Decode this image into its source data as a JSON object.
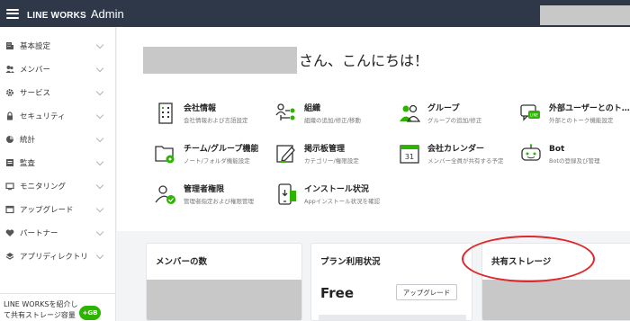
{
  "header": {
    "logo": "LINE WORKS",
    "product": "Admin"
  },
  "sidebar": {
    "items": [
      {
        "label": "基本設定",
        "icon": "building-icon"
      },
      {
        "label": "メンバー",
        "icon": "members-icon"
      },
      {
        "label": "サービス",
        "icon": "gear-icon"
      },
      {
        "label": "セキュリティ",
        "icon": "lock-icon"
      },
      {
        "label": "統計",
        "icon": "pie-chart-icon"
      },
      {
        "label": "監査",
        "icon": "audit-icon"
      },
      {
        "label": "モニタリング",
        "icon": "monitor-icon"
      },
      {
        "label": "アップグレード",
        "icon": "upgrade-icon"
      },
      {
        "label": "パートナー",
        "icon": "partner-icon"
      },
      {
        "label": "アプリディレクトリ",
        "icon": "layers-icon"
      }
    ],
    "promo": {
      "line1": "LINE WORKSを紹介し",
      "line2": "て共有ストレージ容量",
      "badge": "+GB"
    }
  },
  "welcome": {
    "greeting": "さん、こんにちは！"
  },
  "apps": [
    {
      "title": "会社情報",
      "desc": "会社情報および言語設定",
      "icon": "company-icon"
    },
    {
      "title": "組織",
      "desc": "組織の追加/修正/移動",
      "icon": "organization-icon"
    },
    {
      "title": "グループ",
      "desc": "グループの追加/修正",
      "icon": "group-icon"
    },
    {
      "title": "外部ユーザーとのト…",
      "desc": "外部とのトーク機能設定",
      "icon": "external-chat-icon"
    },
    {
      "title": "チーム/グループ機能",
      "desc": "ノート/フォルダ機能設定",
      "icon": "folder-settings-icon"
    },
    {
      "title": "掲示板管理",
      "desc": "カテゴリー/権限設定",
      "icon": "board-edit-icon"
    },
    {
      "title": "会社カレンダー",
      "desc": "メンバー全員が共有する予定",
      "icon": "calendar-icon",
      "icon_text": "31"
    },
    {
      "title": "Bot",
      "desc": "Botの登録及び管理",
      "icon": "bot-icon"
    },
    {
      "title": "管理者権限",
      "desc": "管理者指定および権限管理",
      "icon": "admin-user-icon"
    },
    {
      "title": "インストール状況",
      "desc": "Appインストール状況を確認",
      "icon": "mobile-install-icon"
    }
  ],
  "cards": {
    "members": {
      "title": "メンバーの数"
    },
    "plan": {
      "title": "プラン利用状況",
      "value": "Free",
      "button": "アップグレード"
    },
    "storage": {
      "title": "共有ストレージ"
    }
  },
  "colors": {
    "topbar": "#2f3849",
    "brand_green": "#2db400",
    "annotation_red": "#e0272a"
  }
}
